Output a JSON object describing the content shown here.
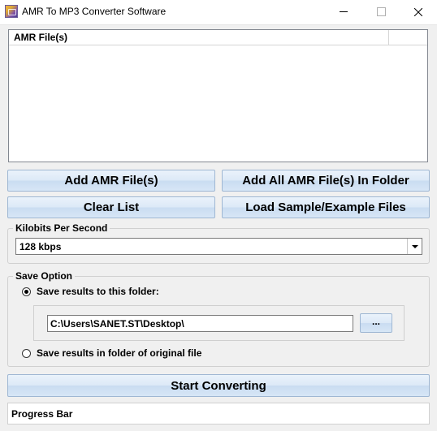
{
  "window": {
    "title": "AMR To MP3 Converter Software",
    "icon": "app-icon"
  },
  "file_list": {
    "columns": [
      "AMR File(s)",
      ""
    ],
    "rows": []
  },
  "buttons": {
    "add_files": "Add AMR File(s)",
    "add_folder": "Add All AMR File(s) In Folder",
    "clear_list": "Clear List",
    "load_samples": "Load Sample/Example Files",
    "start": "Start Converting",
    "browse": "..."
  },
  "bitrate": {
    "group_label": "Kilobits Per Second",
    "selected": "128 kbps"
  },
  "save_option": {
    "group_label": "Save Option",
    "option_folder": "Save results to this folder:",
    "option_original": "Save results in folder of original file",
    "selected": "folder",
    "folder_path": "C:\\Users\\SANET.ST\\Desktop\\"
  },
  "progress": {
    "label": "Progress Bar"
  }
}
